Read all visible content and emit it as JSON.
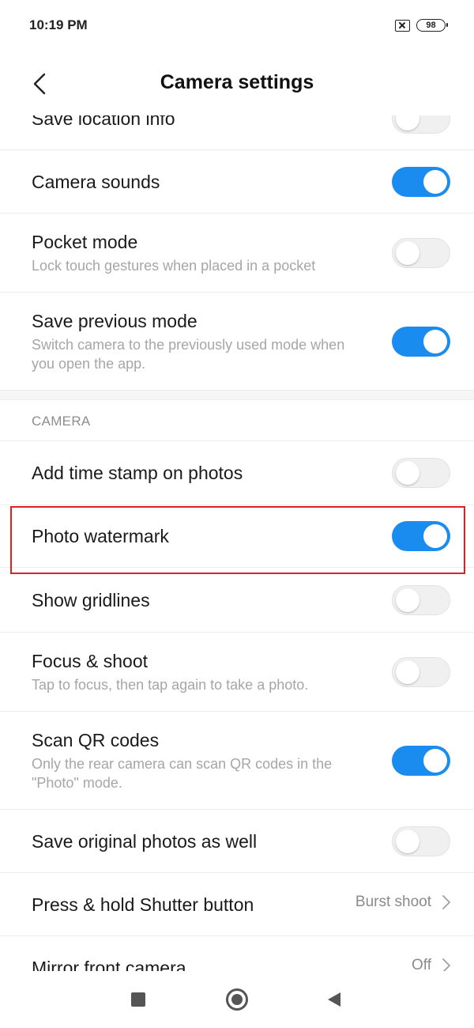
{
  "status": {
    "time": "10:19 PM",
    "battery": "98"
  },
  "header": {
    "title": "Camera settings"
  },
  "rows": [
    {
      "title": "Save location info",
      "subtitle": "",
      "toggle": "off"
    },
    {
      "title": "Camera sounds",
      "subtitle": "",
      "toggle": "on"
    },
    {
      "title": "Pocket mode",
      "subtitle": "Lock touch gestures when placed in a pocket",
      "toggle": "off"
    },
    {
      "title": "Save previous mode",
      "subtitle": "Switch camera to the previously used mode when you open the app.",
      "toggle": "on"
    }
  ],
  "camera_section": {
    "header": "CAMERA",
    "rows": [
      {
        "title": "Add time stamp on photos",
        "subtitle": "",
        "toggle": "off"
      },
      {
        "title": "Photo watermark",
        "subtitle": "",
        "toggle": "on"
      },
      {
        "title": "Show gridlines",
        "subtitle": "",
        "toggle": "off"
      },
      {
        "title": "Focus & shoot",
        "subtitle": "Tap to focus, then tap again to take a photo.",
        "toggle": "off"
      },
      {
        "title": "Scan QR codes",
        "subtitle": "Only the rear camera can scan QR codes in the \"Photo\" mode.",
        "toggle": "on"
      },
      {
        "title": "Save original photos as well",
        "subtitle": "",
        "toggle": "off"
      },
      {
        "title": "Press & hold Shutter button",
        "subtitle": "",
        "value": "Burst shoot"
      },
      {
        "title": "Mirror front camera",
        "subtitle": "",
        "value": "Off"
      }
    ]
  },
  "colors": {
    "accent": "#1a8cf0",
    "highlight": "#e02020"
  },
  "icons": {
    "back": "chevron-left-icon",
    "nav_recents": "square-icon",
    "nav_home": "circle-icon",
    "nav_back": "triangle-left-icon"
  }
}
